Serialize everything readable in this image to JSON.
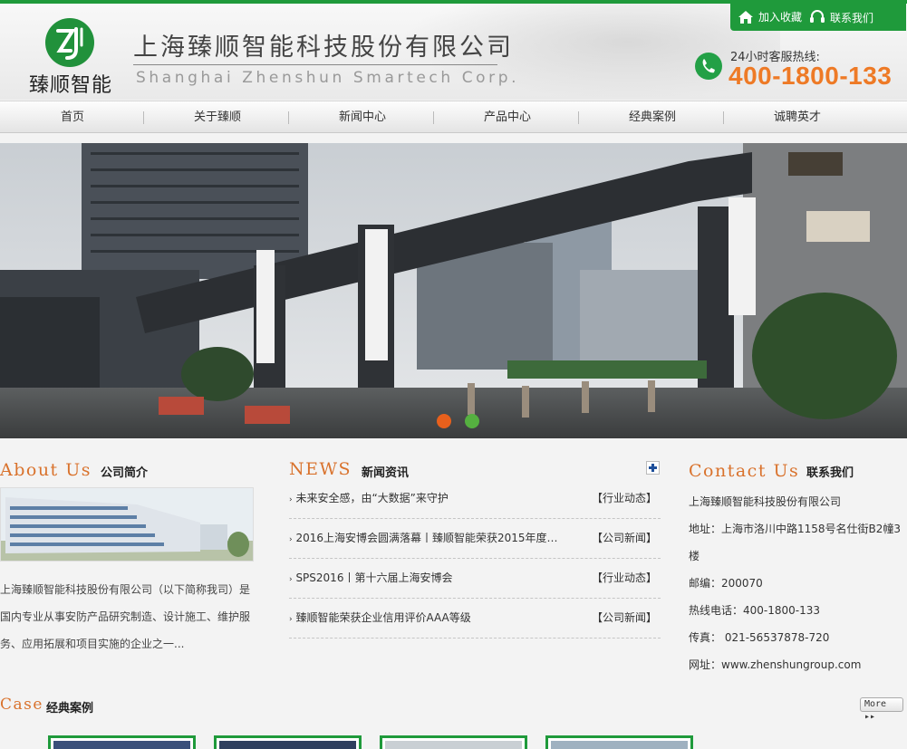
{
  "colors": {
    "brand_green": "#1f9a3b",
    "accent_orange": "#d9722c",
    "hotline_orange": "#ee7a26"
  },
  "header": {
    "logo_cn": "臻顺智能",
    "company_cn": "上海臻顺智能科技股份有限公司",
    "company_en": "Shanghai Zhenshun Smartech Corp.",
    "links": [
      {
        "icon": "home-icon",
        "label": "加入收藏"
      },
      {
        "icon": "headset-icon",
        "label": "联系我们"
      }
    ],
    "hotline_label": "24小时客服热线:",
    "hotline_number": "400-1800-133",
    "hotline_icon": "phone-icon"
  },
  "nav": [
    "首页",
    "关于臻顺",
    "新闻中心",
    "产品中心",
    "经典案例",
    "诚聘英才"
  ],
  "banner": {
    "carousel_dots": [
      {
        "state": "active",
        "color": "#e8601c"
      },
      {
        "state": "inactive",
        "color": "#55b040"
      }
    ]
  },
  "about": {
    "title_en": "About Us",
    "title_cn": "公司简介",
    "text": "上海臻顺智能科技股份有限公司（以下简称我司）是国内专业从事安防产品研究制造、设计施工、维护服务、应用拓展和项目实施的企业之一..."
  },
  "news": {
    "title_en": "NEWS",
    "title_cn": "新闻资讯",
    "items": [
      {
        "title": "未来安全感，由“大数据”来守护",
        "category": "【行业动态】"
      },
      {
        "title": "2016上海安博会圆满落幕丨臻顺智能荣获2015年度…",
        "category": "【公司新闻】"
      },
      {
        "title": "SPS2016丨第十六届上海安博会",
        "category": "【行业动态】"
      },
      {
        "title": "臻顺智能荣获企业信用评价AAA等级",
        "category": "【公司新闻】"
      }
    ]
  },
  "contact": {
    "title_en": "Contact Us",
    "title_cn": "联系我们",
    "lines": [
      "上海臻顺智能科技股份有限公司",
      "地址：上海市洛川中路1158号名仕街B2幢3楼",
      "邮编：200070",
      "热线电话：400-1800-133",
      "传真： 021-56537878-720",
      "网址：www.zhenshungroup.com"
    ]
  },
  "cases": {
    "title_en": "Case",
    "title_cn": "经典案例",
    "more_label": "More",
    "cards": 4
  }
}
